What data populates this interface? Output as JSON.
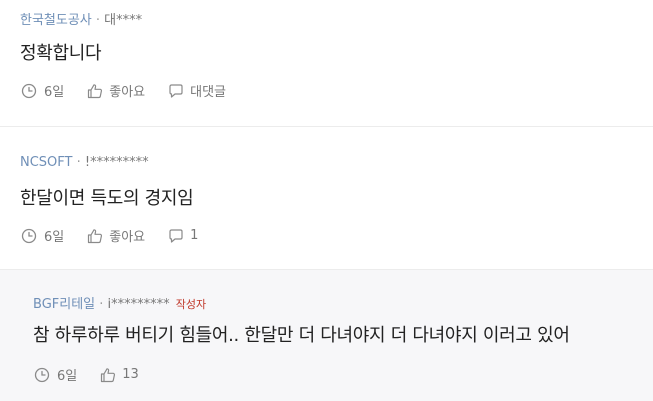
{
  "comments": [
    {
      "company": "한국철도공사",
      "separator": " · ",
      "nickname": "대****",
      "text": "정확합니다",
      "age": "6일",
      "like_label": "좋아요",
      "reply_label": "대댓글"
    },
    {
      "company": "NCSOFT",
      "separator": " · ",
      "nickname": "!*********",
      "text": "한달이면 득도의 경지임",
      "age": "6일",
      "like_label": "좋아요",
      "reply_count": "1"
    },
    {
      "company": "BGF리테일",
      "separator": " · ",
      "nickname": "i*********",
      "writer_badge": "작성자",
      "text": "참 하루하루 버티기 힘들어.. 한달만 더 다녀야지 더 다녀야지 이러고 있어",
      "age": "6일",
      "like_count": "13"
    }
  ]
}
